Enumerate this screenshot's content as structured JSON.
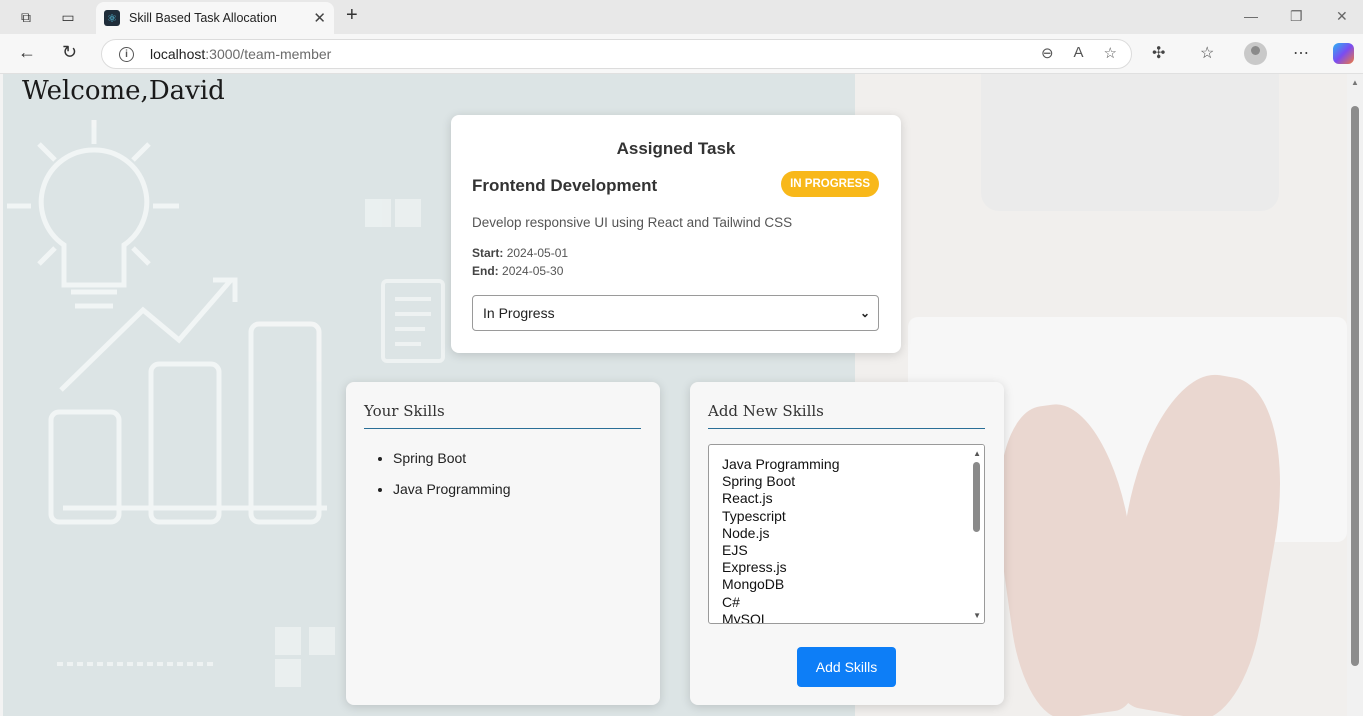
{
  "browser": {
    "tab_title": "Skill Based Task Allocation",
    "url_host": "localhost",
    "url_path": ":3000/team-member"
  },
  "page": {
    "welcome": "Welcome,David"
  },
  "task": {
    "heading": "Assigned Task",
    "name": "Frontend Development",
    "status_badge": "IN PROGRESS",
    "description": "Develop responsive UI using React and Tailwind CSS",
    "start_label": "Start:",
    "start_date": "2024-05-01",
    "end_label": "End:",
    "end_date": "2024-05-30",
    "status_value": "In Progress"
  },
  "skills": {
    "title": "Your Skills",
    "items": [
      "Spring Boot",
      "Java Programming"
    ]
  },
  "add_skills": {
    "title": "Add New Skills",
    "options": [
      "Java Programming",
      "Spring Boot",
      "React.js",
      "Typescript",
      "Node.js",
      "EJS",
      "Express.js",
      "MongoDB",
      "C#",
      "MySQL"
    ],
    "button_label": "Add Skills"
  },
  "colors": {
    "badge": "#f8b81a",
    "button": "#0d7ef7",
    "rule": "#2a6f97"
  }
}
